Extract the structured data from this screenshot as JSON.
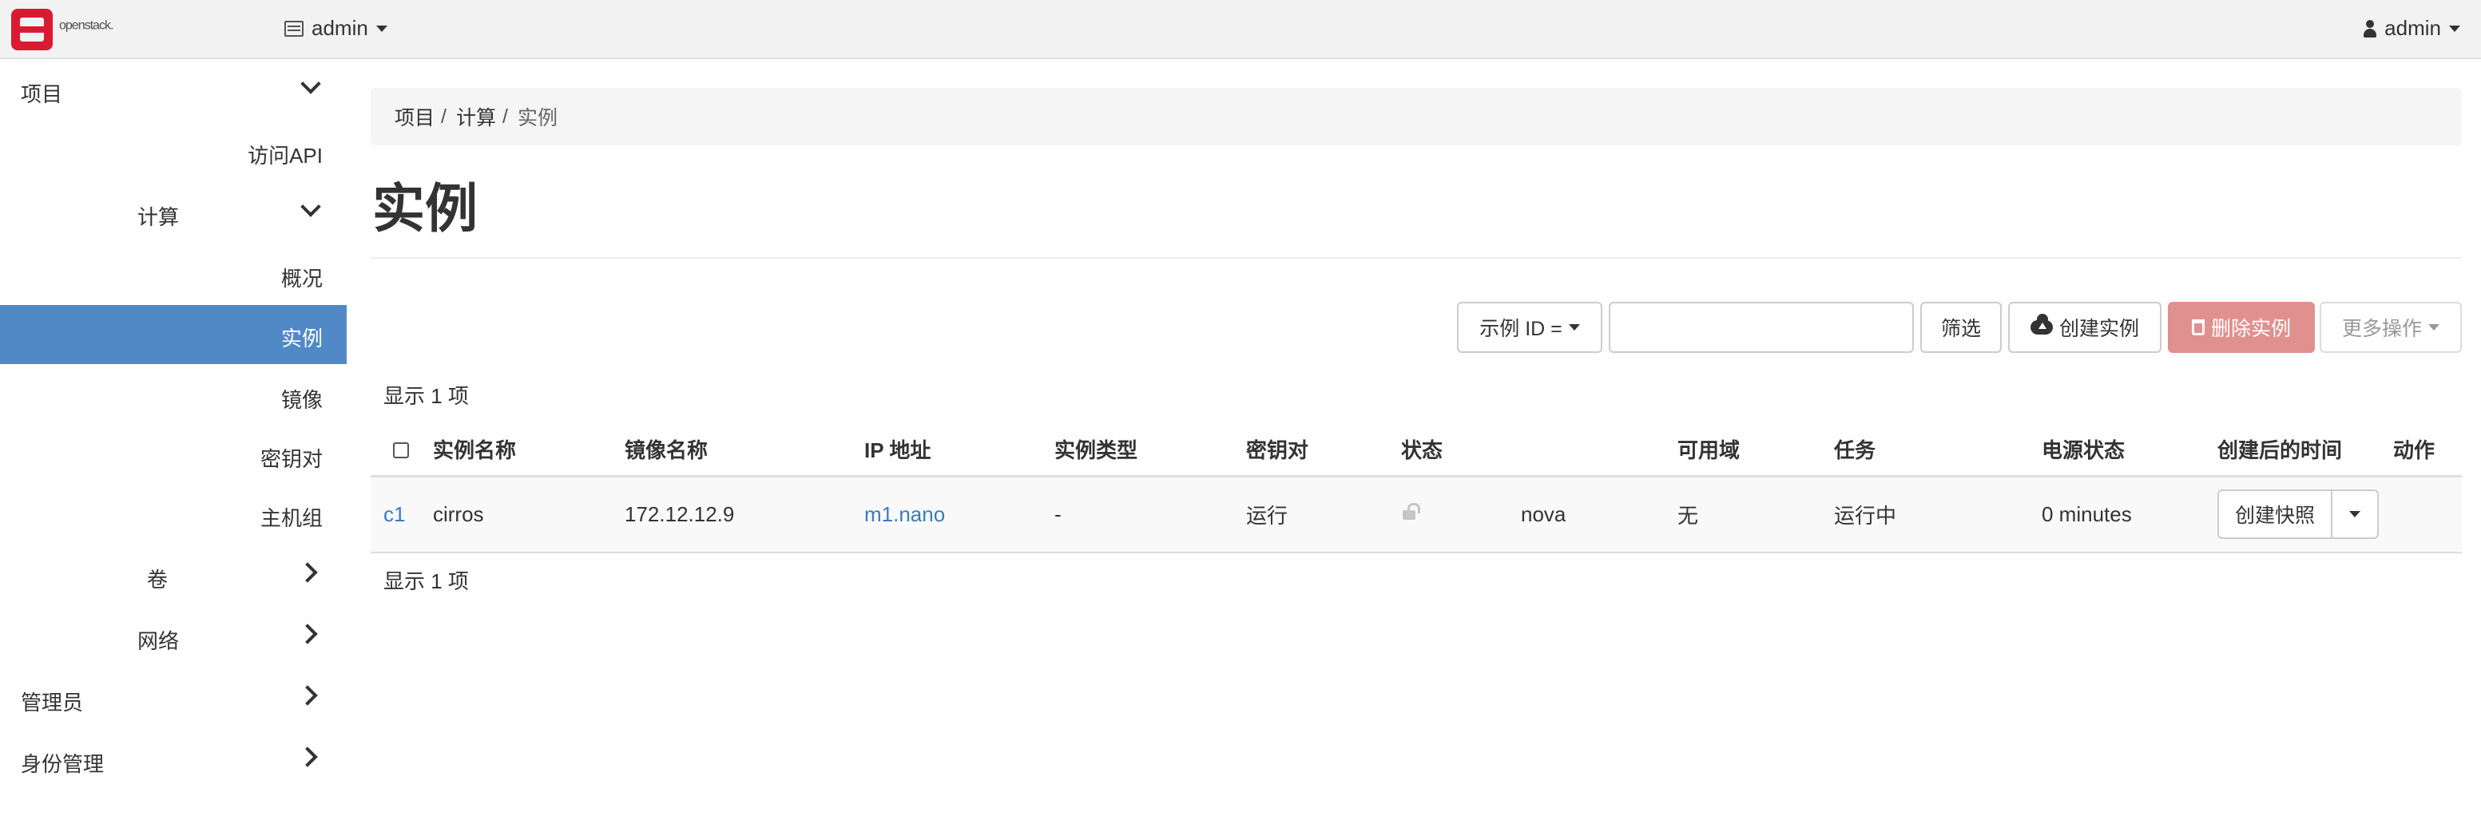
{
  "navbar": {
    "logo_text": "openstack",
    "logo_mark": ".",
    "project": "admin",
    "user": "admin"
  },
  "sidebar": {
    "project": "项目",
    "api_access": "访问API",
    "compute": "计算",
    "overview": "概况",
    "instances": "实例",
    "images": "镜像",
    "key_pairs": "密钥对",
    "server_groups": "主机组",
    "volumes": "卷",
    "network": "网络",
    "admin": "管理员",
    "identity": "身份管理"
  },
  "breadcrumb": [
    "项目",
    "计算",
    "实例"
  ],
  "page_title": "实例",
  "toolbar": {
    "filter_select": "示例 ID =",
    "filter_value": "",
    "filter_button": "筛选",
    "create_button": "创建实例",
    "delete_button": "删除实例",
    "more_button": "更多操作"
  },
  "count_text": "显示 1 项",
  "table": {
    "headers": [
      "实例名称",
      "镜像名称",
      "IP 地址",
      "实例类型",
      "密钥对",
      "状态",
      "可用域",
      "任务",
      "电源状态",
      "创建后的时间",
      "动作"
    ],
    "rows": [
      {
        "name": "c1",
        "image": "cirros",
        "ip": "172.12.12.9",
        "flavor": "m1.nano",
        "key_pair": "-",
        "status": "运行",
        "zone": "nova",
        "task": "无",
        "power": "运行中",
        "age": "0 minutes",
        "action": "创建快照"
      }
    ]
  },
  "colors": {
    "active_nav": "#5089c6",
    "link": "#3a7abf",
    "danger": "#e0908e",
    "brand_red": "#da1a32"
  }
}
